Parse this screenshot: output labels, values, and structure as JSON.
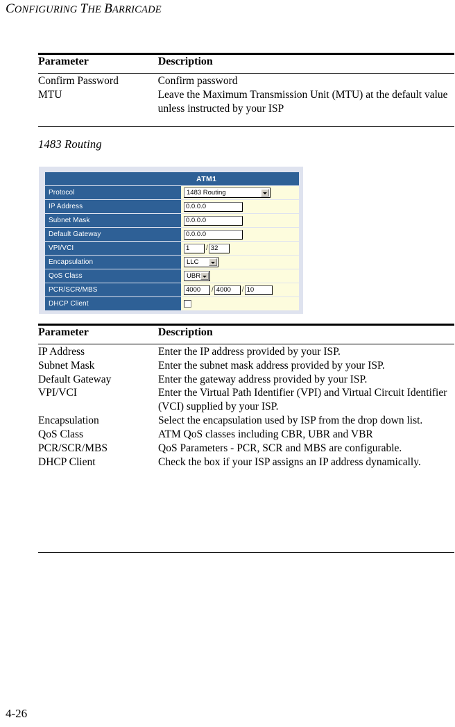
{
  "running_head": {
    "text": "CONFIGURING THE BARRICADE",
    "words": [
      {
        "cap": "C",
        "rest": "ONFIGURING"
      },
      {
        "cap": "T",
        "rest": "HE"
      },
      {
        "cap": "B",
        "rest": "ARRICADE"
      }
    ]
  },
  "section_heading": "1483 Routing",
  "page_number": "4-26",
  "table_top": {
    "headers": [
      "Parameter",
      "Description"
    ],
    "rows": [
      {
        "parameter": "Confirm Password",
        "description": "Confirm password"
      },
      {
        "parameter": "MTU",
        "description": "Leave the Maximum Transmission Unit (MTU) at the default value unless instructed by your ISP"
      }
    ]
  },
  "screenshot": {
    "column_header": "ATM1",
    "rows": [
      {
        "label": "Protocol",
        "control": "select",
        "value": "1483 Routing"
      },
      {
        "label": "IP Address",
        "control": "text",
        "value": "0.0.0.0"
      },
      {
        "label": "Subnet Mask",
        "control": "text",
        "value": "0.0.0.0"
      },
      {
        "label": "Default Gateway",
        "control": "text",
        "value": "0.0.0.0"
      },
      {
        "label": "VPI/VCI",
        "control": "text-pair",
        "value": "1",
        "value2": "32",
        "separator": "/"
      },
      {
        "label": "Encapsulation",
        "control": "select",
        "value": "LLC"
      },
      {
        "label": "QoS Class",
        "control": "select",
        "value": "UBR"
      },
      {
        "label": "PCR/SCR/MBS",
        "control": "text-triple",
        "value": "4000",
        "value2": "4000",
        "value3": "10",
        "separator": "/"
      },
      {
        "label": "DHCP Client",
        "control": "checkbox",
        "checked": false
      }
    ],
    "colors": {
      "label_background": "#2e6096",
      "label_text": "#ffffff",
      "value_background": "#fdfcdd",
      "panel_background": "#dfe3ef"
    }
  },
  "table_bottom": {
    "headers": [
      "Parameter",
      "Description"
    ],
    "rows": [
      {
        "parameter": "IP Address",
        "description": "Enter the IP address provided by your ISP."
      },
      {
        "parameter": "Subnet Mask",
        "description": "Enter the subnet mask address provided by your ISP."
      },
      {
        "parameter": "Default Gateway",
        "description": "Enter the gateway address provided by your ISP."
      },
      {
        "parameter": "VPI/VCI",
        "description": "Enter the Virtual Path Identifier (VPI) and Virtual Circuit Identifier (VCI) supplied by your ISP."
      },
      {
        "parameter": "Encapsulation",
        "description": "Select the encapsulation used by ISP from the drop down list."
      },
      {
        "parameter": "QoS Class",
        "description": "ATM QoS classes including CBR, UBR and VBR"
      },
      {
        "parameter": "PCR/SCR/MBS",
        "description": "QoS Parameters - PCR, SCR and MBS are configurable."
      },
      {
        "parameter": "DHCP Client",
        "description": "Check the box if your ISP assigns an IP address dynamically."
      }
    ]
  }
}
